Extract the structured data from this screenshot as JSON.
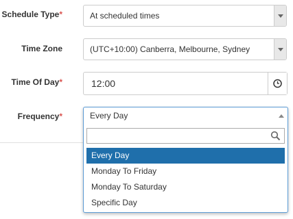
{
  "form": {
    "schedule_type": {
      "label": "Schedule Type",
      "required": "*",
      "value": "At scheduled times"
    },
    "time_zone": {
      "label": "Time Zone",
      "value": "(UTC+10:00) Canberra, Melbourne, Sydney"
    },
    "time_of_day": {
      "label": "Time Of Day",
      "required": "*",
      "value": "12:00"
    },
    "frequency": {
      "label": "Frequency",
      "required": "*",
      "value": "Every Day",
      "search_value": "",
      "options": [
        "Every Day",
        "Monday To Friday",
        "Monday To Saturday",
        "Specific Day"
      ],
      "highlighted_option": "Every Day"
    }
  },
  "colors": {
    "required_marker": "#d9534f",
    "option_highlight": "#1f6fab",
    "focus_border": "#5b9bd5"
  },
  "icons": {
    "select_arrow": "chevron-down-icon",
    "time_picker": "clock-icon",
    "search": "search-icon",
    "dropdown_open": "chevron-up-icon"
  }
}
